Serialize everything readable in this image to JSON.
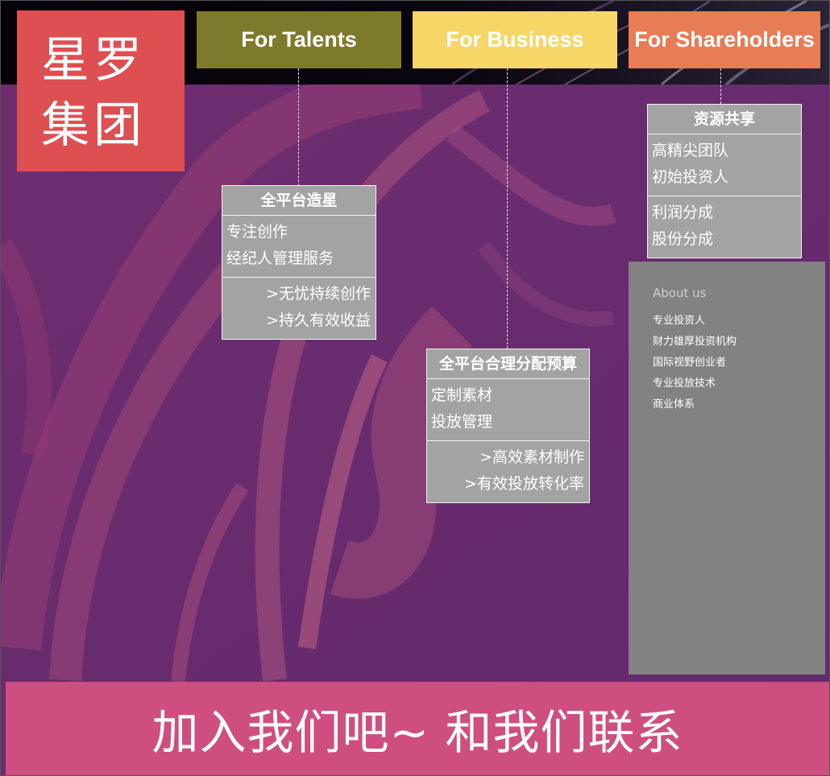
{
  "logo": {
    "chars": [
      "星",
      "罗",
      "集",
      "团"
    ]
  },
  "nav": [
    {
      "label": "For Talents",
      "color": "#7e7a2c"
    },
    {
      "label": "For Business",
      "color": "#f6d667"
    },
    {
      "label": "For Shareholders",
      "color": "#e87c55"
    }
  ],
  "cards": {
    "talents": {
      "header": "全平台造星",
      "items": [
        "专注创作",
        "经纪人管理服务"
      ],
      "benefits": [
        ">无忧持续创作",
        ">持久有效收益"
      ]
    },
    "business": {
      "header": "全平台合理分配预算",
      "items": [
        "定制素材",
        "投放管理"
      ],
      "benefits": [
        ">高效素材制作",
        ">有效投放转化率"
      ]
    },
    "shareholders": {
      "header": "资源共享",
      "items": [
        "高精尖团队",
        "初始投资人"
      ],
      "benefits": [
        "利润分成",
        "股份分成"
      ]
    }
  },
  "about": {
    "title": "About us",
    "items": [
      "专业投资人",
      "财力雄厚投资机构",
      "国际视野创业者",
      "专业投放技术",
      "商业体系"
    ]
  },
  "cta": {
    "label": "加入我们吧~ 和我们联系"
  },
  "colors": {
    "background": "#6a2c6e",
    "logo": "#de4f52",
    "card": "#a3a3a3",
    "about_panel": "#828282",
    "cta": "#cf4e80"
  }
}
